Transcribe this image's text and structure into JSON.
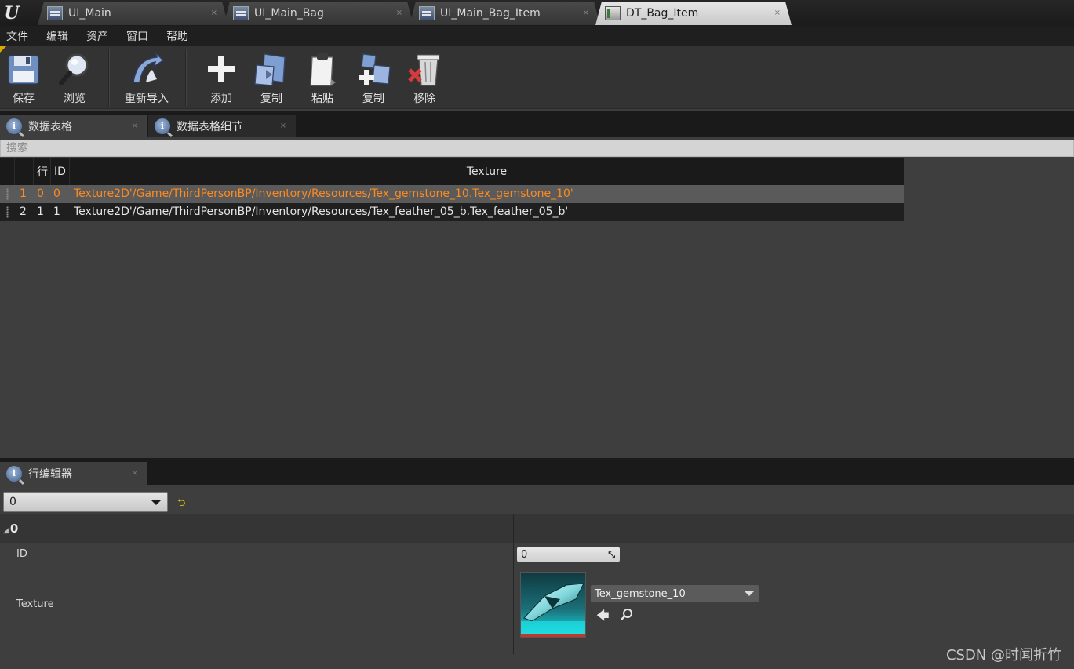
{
  "window": {
    "logo": "U",
    "tabs": [
      {
        "label": "UI_Main",
        "active": false
      },
      {
        "label": "UI_Main_Bag",
        "active": false
      },
      {
        "label": "UI_Main_Bag_Item",
        "active": false
      },
      {
        "label": "DT_Bag_Item",
        "active": true
      }
    ],
    "tab_close_glyph": "×"
  },
  "menu": [
    "文件",
    "编辑",
    "资产",
    "窗口",
    "帮助"
  ],
  "toolbar": {
    "save": "保存",
    "browse": "浏览",
    "reimport": "重新导入",
    "add": "添加",
    "copy": "复制",
    "paste": "粘贴",
    "duplicate": "复制",
    "remove": "移除"
  },
  "panels": {
    "data_table_tab": "数据表格",
    "details_tab": "数据表格细节",
    "row_editor_tab": "行编辑器"
  },
  "search": {
    "placeholder": "搜索"
  },
  "table": {
    "columns": [
      "行",
      "ID",
      "Texture"
    ],
    "rows": [
      {
        "index": "1",
        "row_name": "0",
        "id": "0",
        "texture": "Texture2D'/Game/ThirdPersonBP/Inventory/Resources/Tex_gemstone_10.Tex_gemstone_10'",
        "selected": true
      },
      {
        "index": "2",
        "row_name": "1",
        "id": "1",
        "texture": "Texture2D'/Game/ThirdPersonBP/Inventory/Resources/Tex_feather_05_b.Tex_feather_05_b'",
        "selected": false
      }
    ]
  },
  "row_editor": {
    "selected_row": "0",
    "category": "0",
    "props": {
      "id_label": "ID",
      "id_value": "0",
      "texture_label": "Texture",
      "texture_asset": "Tex_gemstone_10"
    }
  },
  "watermark": "CSDN @时闻折竹",
  "colors": {
    "selected_row_text": "#ff8a1e",
    "accent_yellow": "#d8a900"
  }
}
